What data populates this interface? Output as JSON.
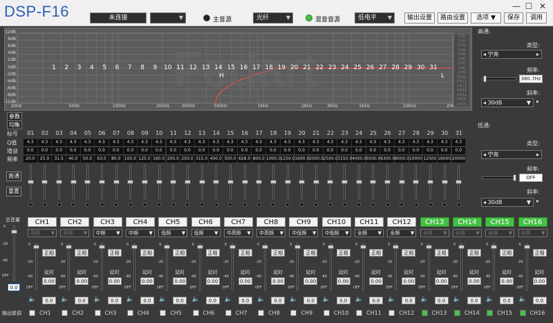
{
  "app": {
    "title": "DSP-F16",
    "status": "未连接"
  },
  "toolbar": {
    "main_source_label": "主音源",
    "source_value": "光纤",
    "mix_source_label": "混音音源",
    "level_value": "低电平",
    "buttons": [
      "输出设置",
      "路由设置",
      "选项",
      "保存",
      "调用"
    ]
  },
  "colors": {
    "accent": "#2b5fb4",
    "green": "#45c045",
    "curve": "#e05050"
  },
  "eq": {
    "y_ticks": [
      "12dB",
      "8dB",
      "6dB",
      "4dB",
      "2dB",
      "0dB",
      "-2dB",
      "-4dB",
      "-6dB",
      "-8dB",
      "-12dB"
    ],
    "x_ticks": [
      "20Hz",
      "50Hz",
      "100Hz",
      "200Hz",
      "300Hz",
      "500Hz",
      "1KHz",
      "2KHz",
      "3KHz",
      "5KHz",
      "10KHz",
      "20KHz"
    ],
    "band_labels": [
      "1",
      "2",
      "3",
      "4",
      "5",
      "6",
      "7",
      "8",
      "9",
      "10",
      "11",
      "12",
      "13",
      "14",
      "15",
      "16",
      "17",
      "18",
      "19",
      "20",
      "21",
      "22",
      "23",
      "24",
      "25",
      "26",
      "27",
      "28",
      "29",
      "30",
      "31"
    ],
    "marker_h": "H",
    "marker_l": "L",
    "side_list": [
      "CH1",
      "CH2",
      "CH3",
      "CH4",
      "CH5",
      "CH6",
      "CH7",
      "CH8",
      "CH9",
      "CH10",
      "CH11",
      "CH12",
      "CH13",
      "CH14",
      "CH15",
      "CH16"
    ]
  },
  "highpass": {
    "title": "高通:",
    "type_label": "类型:",
    "type_value": "宁亮",
    "freq_label": "频率:",
    "freq_value": "380.7Hz",
    "freq_pos": 0.05,
    "slope_label": "斜率:",
    "slope_value": "30dB"
  },
  "lowpass": {
    "title": "低通:",
    "type_label": "类型:",
    "type_value": "宁亮",
    "freq_label": "频率:",
    "freq_value": "OFF",
    "freq_pos": 1.0,
    "slope_label": "斜率:",
    "slope_value": "30dB"
  },
  "param": {
    "tab_param": "参数",
    "tab_eq": "均衡",
    "row_labels": [
      "标号",
      "Q值",
      "增益",
      "频率"
    ],
    "band_numbers": [
      "01",
      "02",
      "03",
      "04",
      "05",
      "06",
      "07",
      "08",
      "09",
      "10",
      "11",
      "12",
      "13",
      "14",
      "15",
      "16",
      "17",
      "18",
      "19",
      "20",
      "21",
      "22",
      "23",
      "24",
      "25",
      "26",
      "27",
      "28",
      "29",
      "30",
      "31"
    ],
    "q_values": [
      "4.3",
      "4.3",
      "4.3",
      "4.3",
      "4.3",
      "4.3",
      "4.3",
      "4.3",
      "4.3",
      "4.3",
      "4.3",
      "4.3",
      "4.3",
      "4.3",
      "4.3",
      "4.3",
      "4.3",
      "4.3",
      "4.3",
      "4.3",
      "4.3",
      "4.3",
      "4.3",
      "4.3",
      "4.3",
      "4.3",
      "4.3",
      "4.3",
      "4.3",
      "4.3",
      "4.3"
    ],
    "gain_values": [
      "0.0",
      "0.0",
      "0.0",
      "0.0",
      "0.0",
      "0.0",
      "0.0",
      "0.0",
      "0.0",
      "0.0",
      "0.0",
      "0.0",
      "0.0",
      "0.0",
      "0.0",
      "0.0",
      "0.0",
      "0.0",
      "0.0",
      "0.0",
      "0.0",
      "0.0",
      "0.0",
      "0.0",
      "0.0",
      "0.0",
      "0.0",
      "0.0",
      "0.0",
      "0.0",
      "0.0"
    ],
    "freq_values": [
      "20.0",
      "25.0",
      "31.5",
      "40.0",
      "50.0",
      "63.0",
      "80.0",
      "100.0",
      "125.0",
      "160.0",
      "200.0",
      "250.0",
      "315.0",
      "400.0",
      "500.0",
      "628.0",
      "800.0",
      "1000.0",
      "1250.0",
      "1600.0",
      "2000.0",
      "2500.0",
      "3150.0",
      "4000.0",
      "5000.0",
      "6300.0",
      "8000.0",
      "10000",
      "12500",
      "16000",
      "20000"
    ],
    "btn_direct": "直通",
    "btn_reset": "重置"
  },
  "master": {
    "label": "总音量",
    "value": "0.0"
  },
  "channels": [
    {
      "name": "CH1",
      "type": "高频",
      "active": false,
      "green": false
    },
    {
      "name": "CH2",
      "type": "高频",
      "active": false,
      "green": false
    },
    {
      "name": "CH3",
      "type": "中频",
      "active": true,
      "green": false
    },
    {
      "name": "CH4",
      "type": "中频",
      "active": true,
      "green": false
    },
    {
      "name": "CH5",
      "type": "低频",
      "active": true,
      "green": false
    },
    {
      "name": "CH6",
      "type": "低频",
      "active": true,
      "green": false
    },
    {
      "name": "CH7",
      "type": "中高频",
      "active": true,
      "green": false
    },
    {
      "name": "CH8",
      "type": "中高频",
      "active": true,
      "green": false
    },
    {
      "name": "CH9",
      "type": "中低频",
      "active": true,
      "green": false
    },
    {
      "name": "CH10",
      "type": "中低频",
      "active": true,
      "green": false
    },
    {
      "name": "CH11",
      "type": "全频",
      "active": true,
      "green": false
    },
    {
      "name": "CH12",
      "type": "全频",
      "active": true,
      "green": false
    },
    {
      "name": "CH13",
      "type": "全频",
      "active": false,
      "green": true
    },
    {
      "name": "CH14",
      "type": "全频",
      "active": false,
      "green": true
    },
    {
      "name": "CH15",
      "type": "全频",
      "active": false,
      "green": true
    },
    {
      "name": "CH16",
      "type": "全频",
      "active": false,
      "green": true
    }
  ],
  "strip": {
    "phase": "正相",
    "delay": "延时",
    "delay_value": "0.00",
    "gain_value": "0.0",
    "scale": [
      "0",
      "-20",
      "-40",
      "OFF"
    ]
  },
  "link": {
    "label": "输出联调",
    "checks": [
      false,
      false,
      false,
      false,
      false,
      false,
      false,
      false,
      false,
      false,
      false,
      false,
      true,
      true,
      true,
      true
    ]
  }
}
